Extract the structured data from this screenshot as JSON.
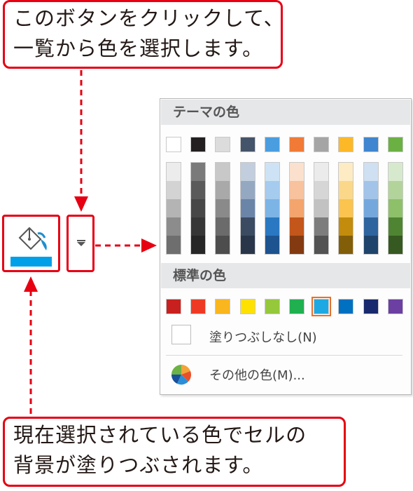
{
  "callouts": {
    "top": {
      "line1": "このボタンをクリックして、",
      "line2": "一覧から色を選択します。"
    },
    "bottom": {
      "line1": "現在選択されている色でセルの",
      "line2": "背景が塗りつぶされます。"
    }
  },
  "toolbar": {
    "fill_icon": "paint-bucket-icon",
    "current_color": "#00a0e9",
    "dropdown_icon": "dropdown-arrow-icon"
  },
  "palette": {
    "theme_header": "テーマの色",
    "standard_header": "標準の色",
    "no_fill_label": "塗りつぶしなし(N)",
    "more_colors_label": "その他の色(M)...",
    "more_colors_icon": "color-wheel-icon",
    "theme_base": [
      "#ffffff",
      "#231f20",
      "#dcdcdc",
      "#44546a",
      "#4a9ee0",
      "#f07a36",
      "#a5a5a5",
      "#fdb827",
      "#3f85d0",
      "#6bb043"
    ],
    "theme_shades": [
      [
        "#ececec",
        "#d3d3d3",
        "#b4b4b4",
        "#8c8c8c",
        "#6e6e6e"
      ],
      [
        "#7a7a7a",
        "#5a5a5a",
        "#474747",
        "#363636",
        "#262626"
      ],
      [
        "#c8c8c8",
        "#a9a9a9",
        "#8a8a8a",
        "#6b6b6b",
        "#4d4d4d"
      ],
      [
        "#c2cedd",
        "#94a8c2",
        "#6b85a8",
        "#3b4b62",
        "#29364a"
      ],
      [
        "#cde3f5",
        "#a5cbee",
        "#7db4e6",
        "#2a78c2",
        "#1d5490"
      ],
      [
        "#fbe0cd",
        "#f7c29d",
        "#f3a56d",
        "#c3561a",
        "#843a11"
      ],
      [
        "#ebebeb",
        "#d6d6d6",
        "#c2c2c2",
        "#7d7d7d",
        "#535353"
      ],
      [
        "#fdebc4",
        "#fbd889",
        "#fac44f",
        "#c38c0c",
        "#835e08"
      ],
      [
        "#cfe0f2",
        "#a2c4e8",
        "#74a8dd",
        "#2e659f",
        "#1f446b"
      ],
      [
        "#d7e9cc",
        "#b2d49b",
        "#8ec06a",
        "#4f8532",
        "#355921"
      ]
    ],
    "standard": [
      "#c8201e",
      "#ee3a24",
      "#fab61e",
      "#ffe100",
      "#96c83c",
      "#20b050",
      "#1ca9e3",
      "#0070c0",
      "#18296e",
      "#6c3fa2"
    ],
    "selected_standard_index": 6
  },
  "colors": {
    "accent_red": "#e60012"
  }
}
